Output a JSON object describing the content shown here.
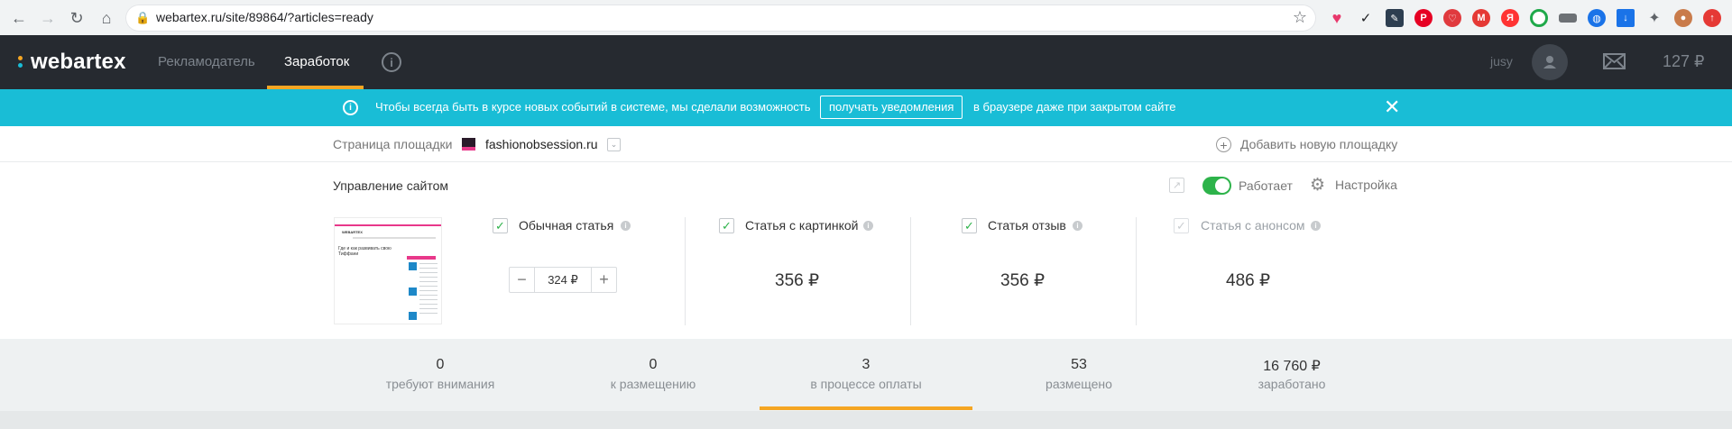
{
  "browser": {
    "url": "webartex.ru/site/89864/?articles=ready"
  },
  "header": {
    "logo_text": "webartex",
    "nav": [
      {
        "label": "Рекламодатель"
      },
      {
        "label": "Заработок"
      }
    ],
    "user_name": "jusy",
    "balance": "127 ₽"
  },
  "notification": {
    "text_before": "Чтобы всегда быть в курсе новых событий в системе, мы сделали возможность",
    "button_label": "получать уведомления",
    "text_after": "в браузере даже при закрытом сайте"
  },
  "site_bar": {
    "label": "Страница площадки",
    "site_name": "fashionobsession.ru",
    "add_label": "Добавить новую площадку"
  },
  "management": {
    "title": "Управление сайтом",
    "status_label": "Работает",
    "settings_label": "Настройка"
  },
  "articles": [
    {
      "label": "Обычная статья",
      "checked": true,
      "value": "324 ₽"
    },
    {
      "label": "Статья с картинкой",
      "checked": true,
      "price": "356 ₽"
    },
    {
      "label": "Статья отзыв",
      "checked": true,
      "price": "356 ₽"
    },
    {
      "label": "Статья с анонсом",
      "checked": false,
      "price": "486 ₽"
    }
  ],
  "thumbnail": {
    "brand": "WEBARTEX",
    "headline": "Где и как развивать свою Тиффани"
  },
  "stats": [
    {
      "value": "0",
      "label": "требуют внимания"
    },
    {
      "value": "0",
      "label": "к размещению"
    },
    {
      "value": "3",
      "label": "в процессе оплаты"
    },
    {
      "value": "53",
      "label": "размещено"
    },
    {
      "value": "16 760 ₽",
      "label": "заработано"
    }
  ],
  "colors": {
    "accent": "#f5a623",
    "notify_bg": "#19bdd6",
    "header_bg": "#262a30",
    "toggle_on": "#2db34a"
  }
}
